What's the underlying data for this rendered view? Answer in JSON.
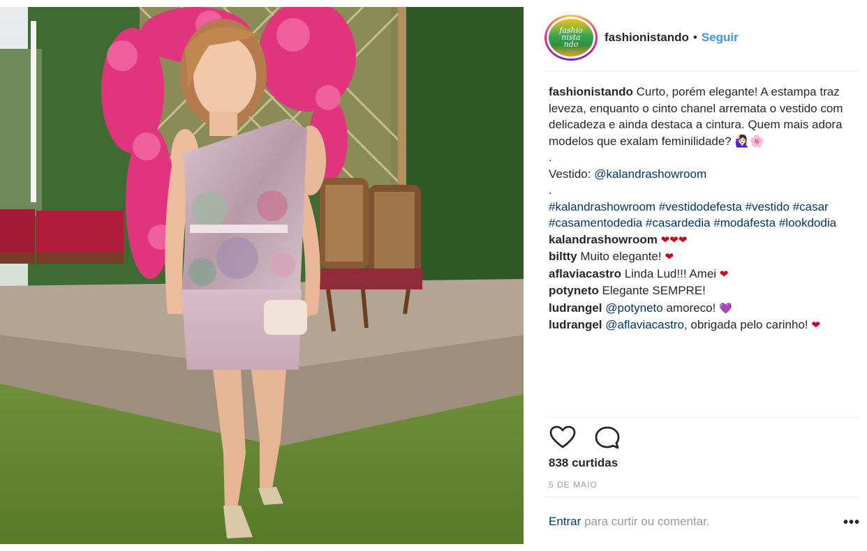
{
  "post": {
    "username": "fashionistando",
    "dot": "•",
    "follow_label": "Seguir",
    "avatar_text": [
      "fashio",
      "nista",
      "ndo"
    ]
  },
  "caption": {
    "username": "fashionistando",
    "text": "Curto, porém elegante! A estampa traz leveza, enquanto o cinto chanel arremata o vestido com delicadeza e ainda destaca a cintura. Quem mais adora modelos que exalam feminilidade? 🙋🏻‍♀️🌸",
    "separator1": ".",
    "dress_label": "Vestido: ",
    "dress_mention": "@kalandrashowroom",
    "separator2": ".",
    "hashtags": "#kalandrashowroom #vestidodefesta #vestido #casar #casamentodedia #casardedia #modafesta #lookdodia"
  },
  "comments": [
    {
      "user": "kalandrashowroom",
      "text": "",
      "emoji": "❤❤❤"
    },
    {
      "user": "biltty",
      "text": "Muito elegante!",
      "emoji": "❤"
    },
    {
      "user": "aflaviacastro",
      "text": "Linda Lud!!! Amei",
      "emoji": "❤"
    },
    {
      "user": "potyneto",
      "text": "Elegante SEMPRE!",
      "emoji": ""
    },
    {
      "user": "ludrangel",
      "mention": "@potyneto",
      "text": "amoreco!",
      "emoji": "💜"
    },
    {
      "user": "ludrangel",
      "mention": "@aflaviacastro",
      "text": ", obrigada pelo carinho!",
      "emoji": "❤"
    }
  ],
  "actions": {
    "like_icon": "heart-outline-icon",
    "comment_icon": "comment-bubble-icon"
  },
  "likes": "838 curtidas",
  "date": "5 DE MAIO",
  "footer": {
    "login_link": "Entrar",
    "login_text": " para curtir ou comentar.",
    "more": "•••"
  },
  "colors": {
    "link": "#003569",
    "follow": "#3897f0",
    "text": "#262626",
    "muted": "#999999",
    "heart": "#d0021b"
  }
}
